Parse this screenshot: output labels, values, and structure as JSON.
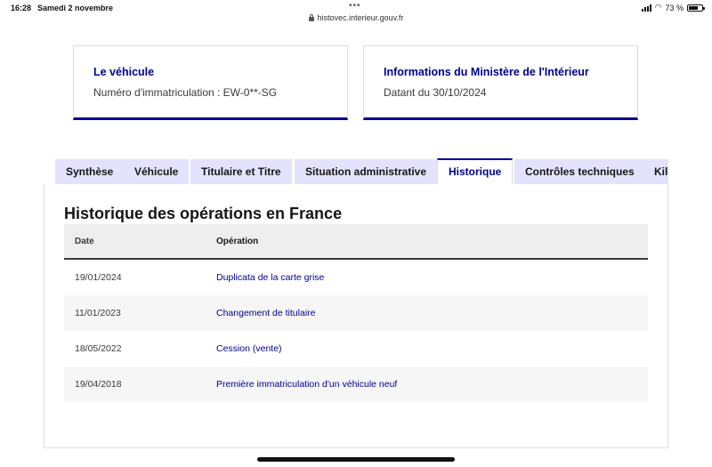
{
  "status_bar": {
    "time": "16:28",
    "date": "Samedi 2 novembre",
    "battery": "73 %",
    "battery_level": 0.73
  },
  "browser": {
    "url": "histovec.interieur.gouv.fr"
  },
  "cards": [
    {
      "title": "Le véhicule",
      "text": "Numéro d'immatriculation : EW-0**-SG"
    },
    {
      "title": "Informations du Ministère de l'Intérieur",
      "text": "Datant du 30/10/2024"
    }
  ],
  "tabs": [
    {
      "label": "Synthèse",
      "active": false
    },
    {
      "label": "Véhicule",
      "active": false
    },
    {
      "label": "Titulaire et Titre",
      "active": false
    },
    {
      "label": "Situation administrative",
      "active": false
    },
    {
      "label": "Historique",
      "active": true
    },
    {
      "label": "Contrôles techniques",
      "active": false
    },
    {
      "label": "Kilométrage",
      "active": false
    }
  ],
  "history": {
    "title": "Historique des opérations en France",
    "columns": [
      "Date",
      "Opération"
    ],
    "rows": [
      {
        "date": "19/01/2024",
        "operation": "Duplicata de la carte grise"
      },
      {
        "date": "11/01/2023",
        "operation": "Changement de titulaire"
      },
      {
        "date": "18/05/2022",
        "operation": "Cession (vente)"
      },
      {
        "date": "19/04/2018",
        "operation": "Première immatriculation d'un véhicule neuf"
      }
    ]
  },
  "colors": {
    "accent": "#000091",
    "tab_bg": "#e3e3fd",
    "header_bg": "#eeeeee"
  }
}
